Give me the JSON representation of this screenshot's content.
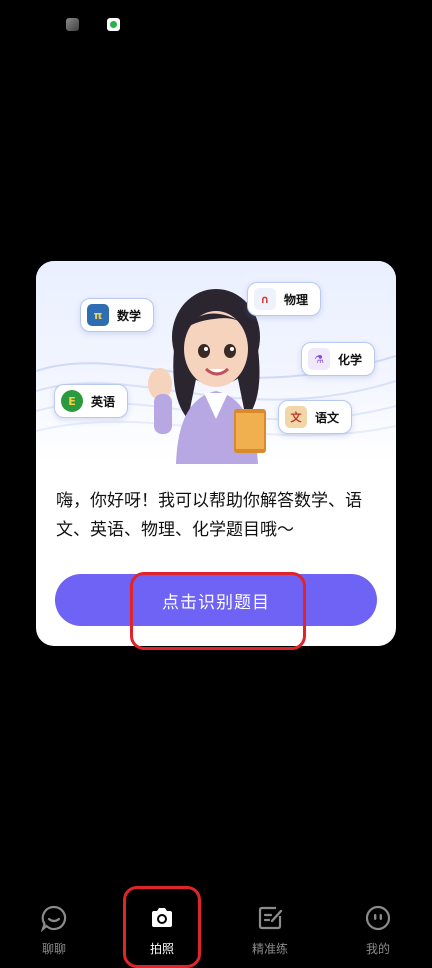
{
  "status_bar": {
    "icons": [
      "app-notification-icon",
      "video-app-notification-icon"
    ]
  },
  "card": {
    "subjects": {
      "math": "数学",
      "physics": "物理",
      "chemistry": "化学",
      "english": "英语",
      "chinese": "语文"
    },
    "message": "嗨，你好呀！我可以帮助你解答数学、语文、英语、物理、化学题目哦～",
    "cta_label": "点击识别题目",
    "accent_color": "#6e63f4"
  },
  "tabbar": {
    "tabs": [
      {
        "label": "聊聊",
        "icon": "chat-icon",
        "active": false
      },
      {
        "label": "拍照",
        "icon": "camera-icon",
        "active": true
      },
      {
        "label": "精准练",
        "icon": "edit-note-icon",
        "active": false
      },
      {
        "label": "我的",
        "icon": "profile-face-icon",
        "active": false
      }
    ]
  },
  "annotation_color": "#e0242b"
}
